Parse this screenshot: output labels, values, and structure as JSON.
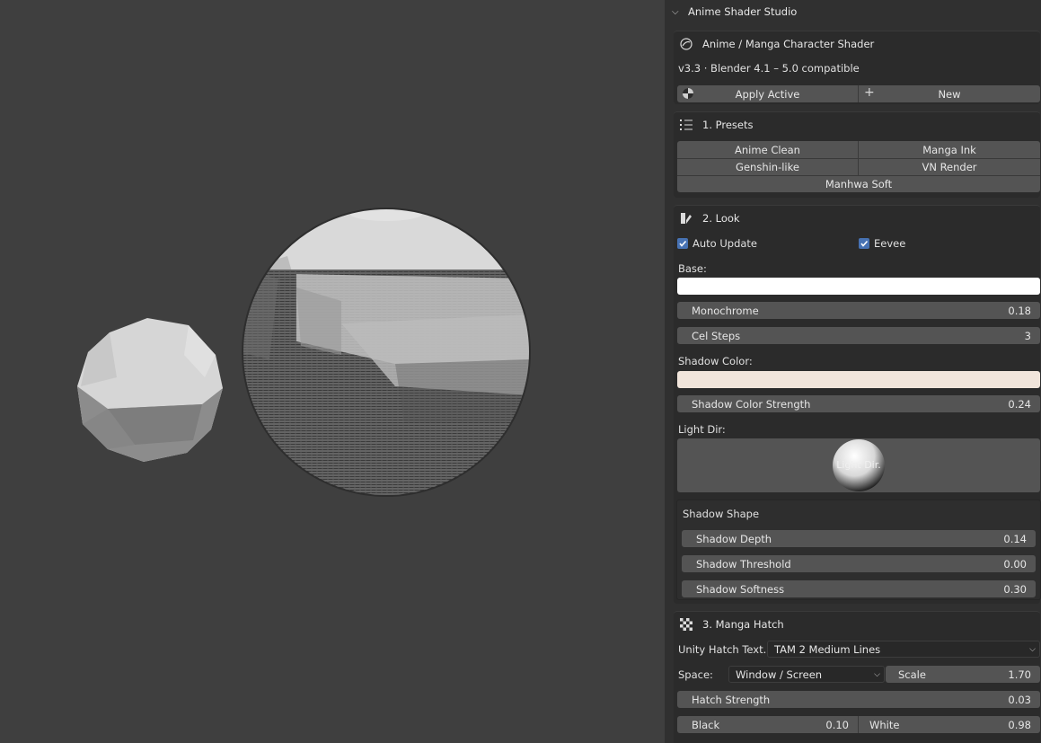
{
  "header": {
    "title": "Anime Shader Studio",
    "chevron_icon": "chevron-down-icon"
  },
  "intro": {
    "title": "Anime / Manga Character Shader",
    "version": "v3.3 · Blender 4.1 – 5.0 compatible",
    "apply_label": "Apply Active",
    "new_label": "New",
    "plus_glyph": "+"
  },
  "presets": {
    "title": "1. Presets",
    "items": [
      "Anime Clean",
      "Manga Ink",
      "Genshin-like",
      "VN Render",
      "Manhwa Soft"
    ]
  },
  "look": {
    "title": "2. Look",
    "auto_update": {
      "label": "Auto Update",
      "checked": true
    },
    "eevee": {
      "label": "Eevee",
      "checked": true
    },
    "base_label": "Base:",
    "base_color": "#ffffff",
    "monochrome": {
      "label": "Monochrome",
      "value": "0.18"
    },
    "cel_steps": {
      "label": "Cel Steps",
      "value": "3"
    },
    "shadow_color_label": "Shadow Color:",
    "shadow_color": "#f1e5db",
    "shadow_color_strength": {
      "label": "Shadow Color Strength",
      "value": "0.24"
    },
    "light_dir_label": "Light Dir:",
    "light_dir_widget_label": "Light Dir.",
    "shadow_shape": {
      "title": "Shadow Shape",
      "depth": {
        "label": "Shadow Depth",
        "value": "0.14"
      },
      "threshold": {
        "label": "Shadow Threshold",
        "value": "0.00"
      },
      "softness": {
        "label": "Shadow Softness",
        "value": "0.30"
      }
    }
  },
  "hatch": {
    "title": "3. Manga Hatch",
    "texture_label": "Unity Hatch Text...",
    "texture_value": "TAM 2 Medium Lines",
    "space_label": "Space:",
    "space_value": "Window / Screen",
    "scale": {
      "label": "Scale",
      "value": "1.70"
    },
    "strength": {
      "label": "Hatch Strength",
      "value": "0.03"
    },
    "black": {
      "label": "Black",
      "value": "0.10"
    },
    "white": {
      "label": "White",
      "value": "0.98"
    }
  },
  "colors": {
    "accent": "#4772b3",
    "panel": "#2b2b2b",
    "widget": "#545454",
    "viewport": "#3f3f3f"
  }
}
